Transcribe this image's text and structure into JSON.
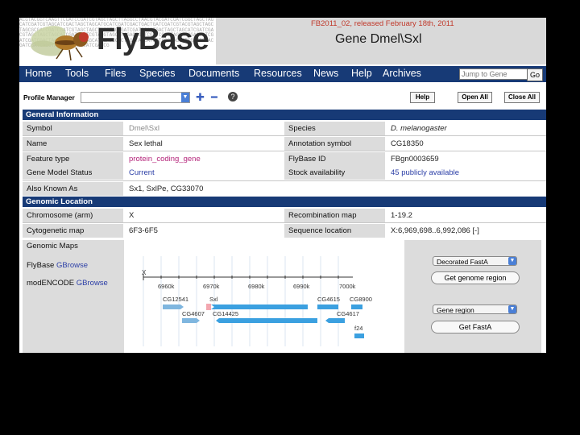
{
  "banner": {
    "dna_text": "ACGTACGGTCAAGTTCGATCCGATCGTAGCTAGCTTAGGCCTAACGTACGATCGATCGGCTAGCTAGCATCGATCGTAGCATCGACTAGCTAGCATGCATCGATCGACTGACTGATCGATCGTACGTAGCTAGCTAGCGCGATCGATCGATCGTAGCTAGCTAGCTAGCGATCGATCGACTGACTAGCTAGCATCGATCGACGTAGCTAGCTAGCATCGATCGATCGTACGTAGCATCGACTGATCGATCGACTAGCATCGACGATCGATCGATCGACTACGTAGCTAGCTAGCATCGATCGACTAGCTAGCATCGTAGCTAGCATCGATCGTACGATCGATCAGCTAGCTAGCTAGCATCGATCG",
    "brand": "FlyBase",
    "release": "FB2011_02, released February 18th, 2011",
    "gene_title": "Gene Dmel\\Sxl"
  },
  "nav": {
    "items": [
      "Home",
      "Tools",
      "Files",
      "Species",
      "Documents",
      "Resources",
      "News",
      "Help",
      "Archives"
    ],
    "jump_placeholder": "Jump to Gene",
    "go": "Go"
  },
  "toolbar": {
    "profile_manager": "Profile Manager",
    "help": "Help",
    "open_all": "Open All",
    "close_all": "Close All"
  },
  "general": {
    "header": "General Information",
    "rows": [
      {
        "label": "Symbol",
        "value": "Dmel\\Sxl",
        "label2": "Species",
        "value2": "D. melanogaster"
      },
      {
        "label": "Name",
        "value": "Sex lethal",
        "label2": "Annotation symbol",
        "value2": "CG18350"
      },
      {
        "label": "Feature type",
        "value": "protein_coding_gene",
        "label2": "FlyBase ID",
        "value2": "FBgn0003659"
      },
      {
        "label": "Gene Model Status",
        "value": "Current",
        "label2": "Stock availability",
        "value2": "45 publicly available"
      },
      {
        "label": "Also Known As",
        "value": "Sx1, SxlPe, CG33070"
      }
    ]
  },
  "genomic": {
    "header": "Genomic Location",
    "rows": [
      {
        "label": "Chromosome (arm)",
        "value": "X",
        "label2": "Recombination map",
        "value2": "1-19.2"
      },
      {
        "label": "Cytogenetic map",
        "value": "6F3-6F5",
        "label2": "Sequence location",
        "value2": "X:6,969,698..6,992,086 [-]"
      }
    ]
  },
  "maps": {
    "title": "Genomic Maps",
    "flybase_prefix": "FlyBase ",
    "modencode_prefix": "modENCODE ",
    "gbrowse": "GBrowse",
    "ruler_label": "X",
    "ticks": [
      "6960k",
      "6970k",
      "6980k",
      "6990k",
      "7000k"
    ],
    "genes": [
      "CG12541",
      "Sxl",
      "CG4615",
      "CG8900",
      "CG4607",
      "CG14425",
      "CG4617",
      "f24"
    ],
    "decorated_fasta": "Decorated FastA",
    "get_genome_region": "Get genome region",
    "gene_region": "Gene region",
    "get_fasta": "Get FastA"
  }
}
